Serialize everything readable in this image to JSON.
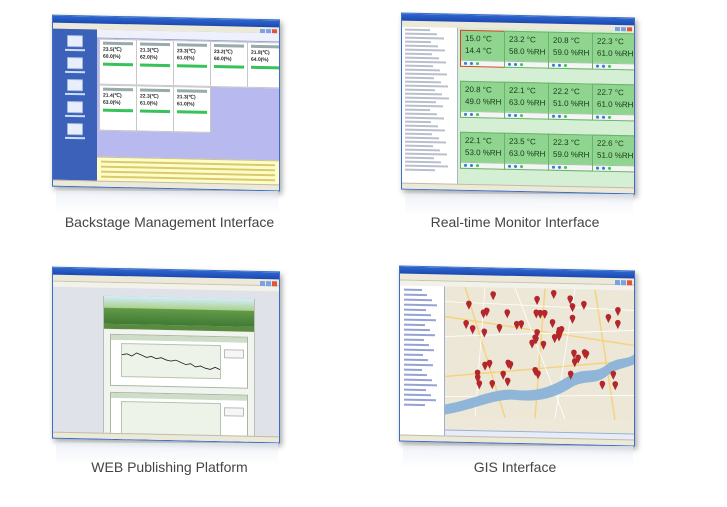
{
  "panels": [
    {
      "caption": "Backstage Management Interface",
      "readings": [
        [
          "23.5(℃)",
          "60.0(%)"
        ],
        [
          "21.3(℃)",
          "62.0(%)"
        ],
        [
          "23.3(℃)",
          "61.0(%)"
        ],
        [
          "23.2(℃)",
          "60.0(%)"
        ],
        [
          "21.8(℃)",
          "64.0(%)"
        ],
        [
          "21.4(℃)",
          "63.0(%)"
        ],
        [
          "22.3(℃)",
          "61.0(%)"
        ],
        [
          "21.3(℃)",
          "61.0(%)"
        ]
      ]
    },
    {
      "caption": "Real-time Monitor Interface",
      "cells": [
        {
          "t": "15.0 °C",
          "h": "14.4 °C"
        },
        {
          "t": "23.2 °C",
          "h": "58.0 %RH"
        },
        {
          "t": "20.8 °C",
          "h": "59.0 %RH"
        },
        {
          "t": "22.3 °C",
          "h": "61.0 %RH"
        },
        {
          "t": "20.8 °C",
          "h": "49.0 %RH"
        },
        {
          "t": "22.1 °C",
          "h": "63.0 %RH"
        },
        {
          "t": "22.2 °C",
          "h": "51.0 %RH"
        },
        {
          "t": "22.7 °C",
          "h": "61.0 %RH"
        },
        {
          "t": "22.1 °C",
          "h": "53.0 %RH"
        },
        {
          "t": "23.5 °C",
          "h": "63.0 %RH"
        },
        {
          "t": "22.3 °C",
          "h": "59.0 %RH"
        },
        {
          "t": "22.6 °C",
          "h": "51.0 %RH"
        }
      ]
    },
    {
      "caption": "WEB Publishing Platform"
    },
    {
      "caption": "GIS Interface"
    }
  ],
  "colors": {
    "titlebar": "#2f66d0",
    "sensor_cell": "#8fd48f",
    "status_green": "#38c25a",
    "map_pin": "#b3262b",
    "river": "#8fb6d9"
  }
}
